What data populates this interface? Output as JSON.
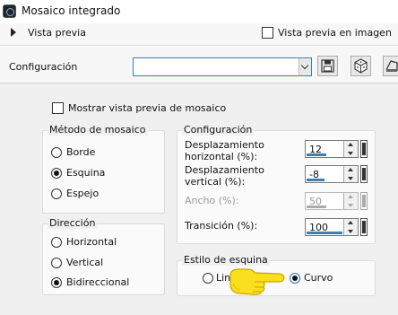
{
  "window": {
    "title": "Mosaico integrado"
  },
  "preview_bar": {
    "toggle_label": "Vista previa",
    "image_preview_label": "Vista previa en imagen"
  },
  "config_bar": {
    "label": "Configuración",
    "preset_value": ""
  },
  "show_tile_preview_label": "Mostrar vista previa de mosaico",
  "tiling_method": {
    "title": "Método de mosaico",
    "options": [
      "Borde",
      "Esquina",
      "Espejo"
    ],
    "selected": "Esquina"
  },
  "direction": {
    "title": "Dirección",
    "options": [
      "Horizontal",
      "Vertical",
      "Bidireccional"
    ],
    "selected": "Bidireccional"
  },
  "settings": {
    "title": "Configuración",
    "horizontal_offset": {
      "label_line1": "Desplazamiento",
      "label_line2": "horizontal (%):",
      "value": "12",
      "fill_pct": 60
    },
    "vertical_offset": {
      "label_line1": "Desplazamiento",
      "label_line2": "vertical (%):",
      "value": "-8",
      "fill_pct": 55
    },
    "width": {
      "label": "Ancho (%):",
      "value": "50",
      "fill_pct": 50
    },
    "transition": {
      "label": "Transición (%):",
      "value": "100",
      "fill_pct": 100
    }
  },
  "corner_style": {
    "title": "Estilo de esquina",
    "linear_label_visible": "Lin",
    "curved_label": "Curvo",
    "selected": "Curvo"
  }
}
